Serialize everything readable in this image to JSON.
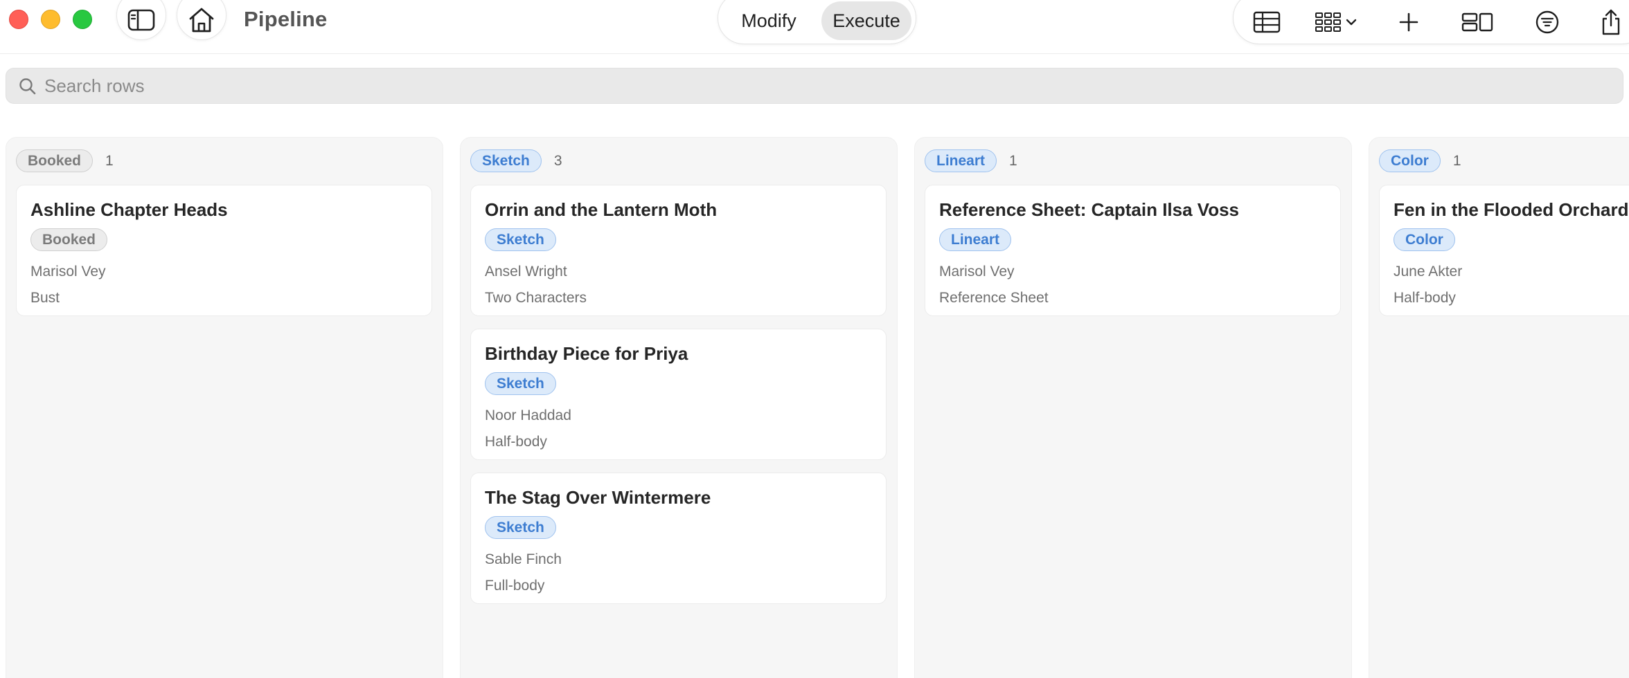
{
  "window": {
    "title": "Pipeline"
  },
  "mode_tabs": [
    {
      "label": "Modify",
      "active": false
    },
    {
      "label": "Execute",
      "active": true
    }
  ],
  "search": {
    "placeholder": "Search rows",
    "value": ""
  },
  "toolbar_icons": [
    "table-view-icon",
    "grid-view-icon",
    "add-icon",
    "layout-icon",
    "filter-icon",
    "share-icon"
  ],
  "colors": {
    "blue_badge_bg": "#dceafa",
    "blue_badge_text": "#3d7dd1",
    "gray_badge_bg": "#ececec"
  },
  "columns": [
    {
      "name": "Booked",
      "count": "1",
      "style": "gray",
      "cards": [
        {
          "title": "Ashline Chapter Heads",
          "status": "Booked",
          "client": "Marisol Vey",
          "type": "Bust"
        }
      ]
    },
    {
      "name": "Sketch",
      "count": "3",
      "style": "blue",
      "cards": [
        {
          "title": "Orrin and the Lantern Moth",
          "status": "Sketch",
          "client": "Ansel Wright",
          "type": "Two Characters"
        },
        {
          "title": "Birthday Piece for Priya",
          "status": "Sketch",
          "client": "Noor Haddad",
          "type": "Half-body"
        },
        {
          "title": "The Stag Over Wintermere",
          "status": "Sketch",
          "client": "Sable Finch",
          "type": "Full-body"
        }
      ]
    },
    {
      "name": "Lineart",
      "count": "1",
      "style": "blue",
      "cards": [
        {
          "title": "Reference Sheet: Captain Ilsa Voss",
          "status": "Lineart",
          "client": "Marisol Vey",
          "type": "Reference Sheet"
        }
      ]
    },
    {
      "name": "Color",
      "count": "1",
      "style": "blue",
      "cards": [
        {
          "title": "Fen in the Flooded Orchard",
          "status": "Color",
          "client": "June Akter",
          "type": "Half-body"
        }
      ]
    }
  ]
}
